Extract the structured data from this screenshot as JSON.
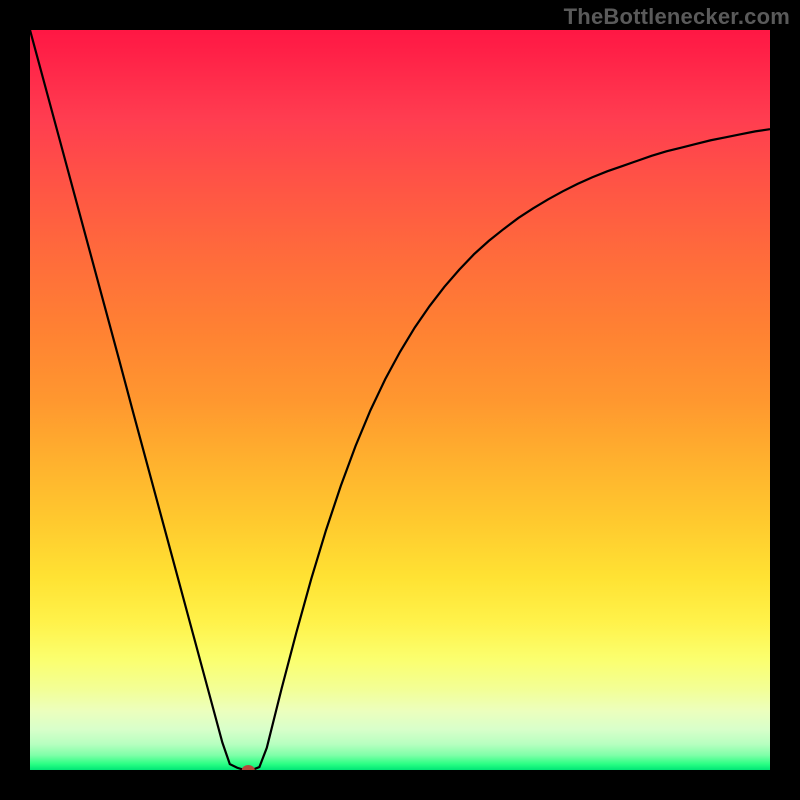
{
  "attribution": "TheBottlenecker.com",
  "chart_data": {
    "type": "line",
    "title": "",
    "xlabel": "",
    "ylabel": "",
    "xlim": [
      0,
      100
    ],
    "ylim": [
      0,
      100
    ],
    "x": [
      0,
      2,
      4,
      6,
      8,
      10,
      12,
      14,
      16,
      18,
      20,
      22,
      24,
      26,
      27,
      28,
      29,
      30,
      31,
      32,
      34,
      36,
      38,
      40,
      42,
      44,
      46,
      48,
      50,
      52,
      54,
      56,
      58,
      60,
      62,
      64,
      66,
      68,
      70,
      72,
      74,
      76,
      78,
      80,
      82,
      84,
      86,
      88,
      90,
      92,
      94,
      96,
      98,
      100
    ],
    "values": [
      100,
      92.6,
      85.2,
      77.8,
      70.4,
      63.0,
      55.6,
      48.1,
      40.7,
      33.3,
      25.9,
      18.5,
      11.1,
      3.7,
      0.8,
      0.3,
      0.0,
      0.0,
      0.4,
      3.0,
      11.0,
      18.6,
      25.8,
      32.4,
      38.4,
      43.8,
      48.6,
      52.8,
      56.5,
      59.8,
      62.7,
      65.3,
      67.6,
      69.7,
      71.5,
      73.1,
      74.6,
      75.9,
      77.1,
      78.2,
      79.2,
      80.1,
      80.9,
      81.6,
      82.3,
      83.0,
      83.6,
      84.1,
      84.6,
      85.1,
      85.5,
      85.9,
      86.3,
      86.6
    ],
    "marker": {
      "x": 29.5,
      "y": 0.0,
      "color": "#b64a3c"
    },
    "gradient_stops": [
      {
        "pos": 0.0,
        "color": "#ff1744"
      },
      {
        "pos": 0.4,
        "color": "#ff8033"
      },
      {
        "pos": 0.74,
        "color": "#ffe233"
      },
      {
        "pos": 0.92,
        "color": "#ecffbd"
      },
      {
        "pos": 1.0,
        "color": "#00e676"
      }
    ]
  }
}
